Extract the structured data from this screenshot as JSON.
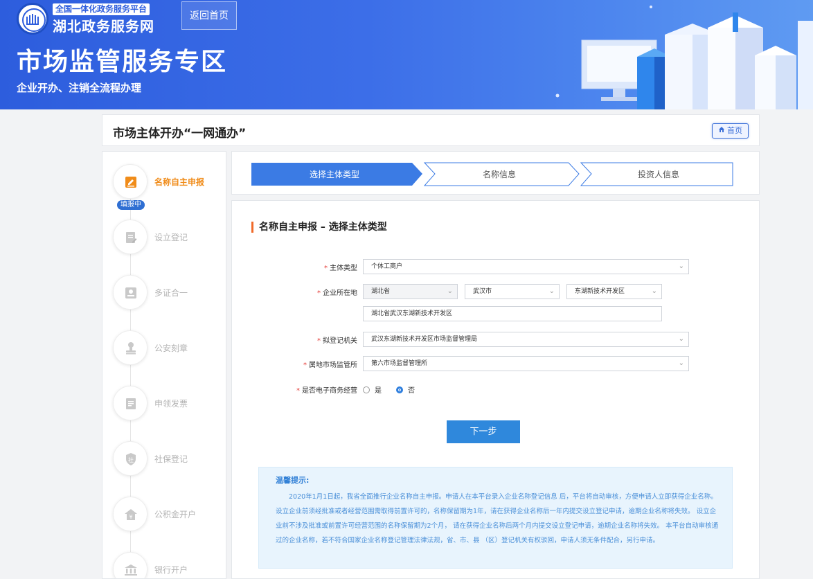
{
  "header": {
    "platform_label": "全国一体化政务服务平台",
    "site_name": "湖北政务服务网",
    "return_home": "返回首页",
    "banner_title": "市场监管服务专区",
    "banner_subtitle": "企业开办、注销全流程办理"
  },
  "titlebar": {
    "title": "市场主体开办“一网通办”",
    "home_button": "首页"
  },
  "sidebar": {
    "active_badge": "填报中",
    "items": [
      {
        "label": "名称自主申报",
        "icon": "edit-icon",
        "active": true
      },
      {
        "label": "设立登记",
        "icon": "form-icon",
        "active": false
      },
      {
        "label": "多证合一",
        "icon": "certificate-icon",
        "active": false
      },
      {
        "label": "公安刻章",
        "icon": "stamp-icon",
        "active": false
      },
      {
        "label": "申领发票",
        "icon": "invoice-icon",
        "active": false
      },
      {
        "label": "社保登记",
        "icon": "shield-icon",
        "active": false
      },
      {
        "label": "公积金开户",
        "icon": "house-yen-icon",
        "active": false
      },
      {
        "label": "银行开户",
        "icon": "bank-icon",
        "active": false
      }
    ]
  },
  "progress": {
    "steps": [
      "选择主体类型",
      "名称信息",
      "投资人信息"
    ],
    "current": 0
  },
  "form": {
    "section_title": "名称自主申报 – 选择主体类型",
    "required_mark": "*",
    "subject_type": {
      "label": "主体类型",
      "value": "个体工商户"
    },
    "location": {
      "label": "企业所在地",
      "province": "湖北省",
      "city": "武汉市",
      "district": "东湖新技术开发区",
      "address": "湖北省武汉东湖新技术开发区"
    },
    "registration_authority": {
      "label": "拟登记机关",
      "value": "武汉东湖新技术开发区市场监督管理局"
    },
    "local_office": {
      "label": "属地市场监管所",
      "value": "第六市场监督管理所"
    },
    "ecommerce": {
      "label": "是否电子商务经营",
      "options": [
        "是",
        "否"
      ],
      "selected": "否"
    },
    "next_button": "下一步"
  },
  "tip": {
    "title": "温馨提示:",
    "body": "2020年1月1日起，我省全面推行企业名称自主申报。申请人在本平台录入企业名称登记信息 后，平台将自动审核，方便申请人立即获得企业名称。 设立企业前须经批准或者经营范围需取得前置许可的，名称保留期为1年，请在获得企业名称后一年内提交设立登记申请，逾期企业名称将失效。 设立企业前不涉及批准或前置许可经营范围的名称保留期为2个月， 请在获得企业名称后两个月内提交设立登记申请，逾期企业名称将失效。 本平台自动审核通过的企业名称，若不符合国家企业名称登记管理法律法规，省、市、县 （区）登记机关有权驳回，申请人须无条件配合，另行申请。"
  },
  "colors": {
    "banner_blue": "#3c6ee8",
    "active_step": "#3b7be4",
    "accent_orange": "#f08c1a",
    "button_blue": "#2f88dc"
  }
}
